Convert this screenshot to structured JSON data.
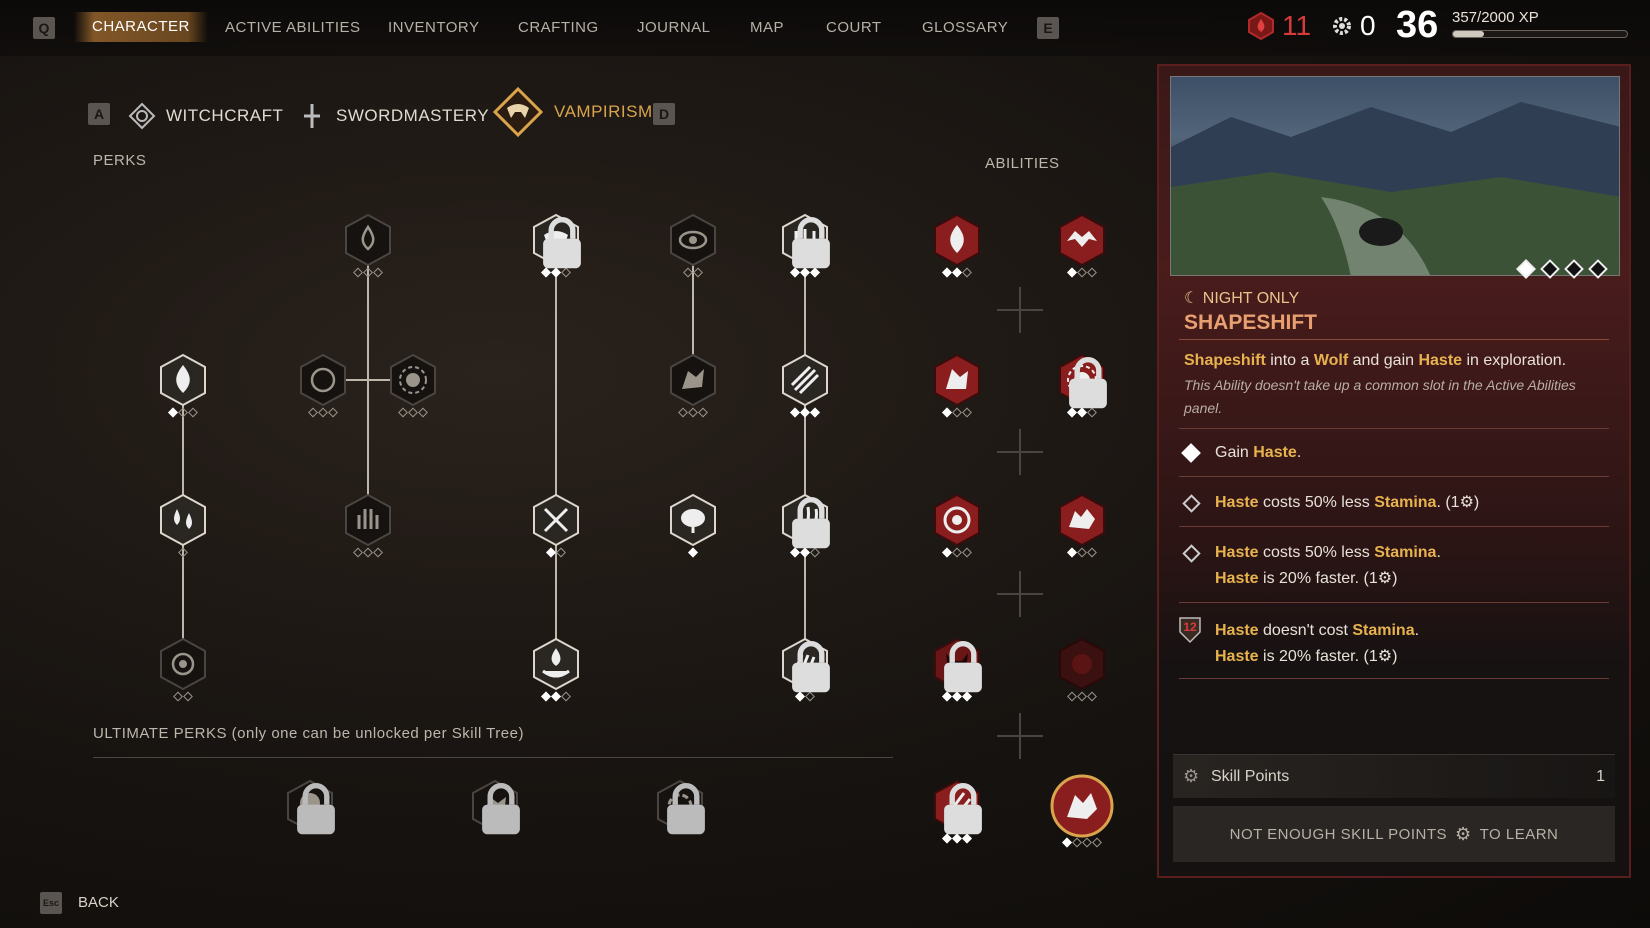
{
  "nav": {
    "left_key": "Q",
    "right_key": "E",
    "tabs": [
      "CHARACTER",
      "ACTIVE ABILITIES",
      "INVENTORY",
      "CRAFTING",
      "JOURNAL",
      "MAP",
      "COURT",
      "GLOSSARY"
    ],
    "active_tab": "CHARACTER"
  },
  "stats": {
    "blood": "11",
    "skill_points": "0",
    "level": "36",
    "xp_text": "357/2000 XP",
    "xp_fraction": 0.18
  },
  "trees": {
    "left_key": "A",
    "right_key": "D",
    "items": [
      "WITCHCRAFT",
      "SWORDMASTERY",
      "VAMPIRISM"
    ],
    "active": "VAMPIRISM"
  },
  "labels": {
    "perks": "PERKS",
    "abilities": "ABILITIES",
    "ultimate": "ULTIMATE PERKS (only one can be unlocked per Skill Tree)",
    "back_key": "Esc",
    "back": "BACK"
  },
  "detail": {
    "tag": "NIGHT ONLY",
    "title": "SHAPESHIFT",
    "desc_parts": [
      "Shapeshift",
      " into a ",
      "Wolf",
      " and gain ",
      "Haste",
      " in exploration."
    ],
    "note": "This Ability doesn't take up a common slot in the Active Abilities panel.",
    "rank1": [
      "Gain ",
      "Haste",
      "."
    ],
    "rank2": [
      "Haste",
      " costs 50% less ",
      "Stamina",
      ".  (1",
      ")"
    ],
    "rank3a": [
      "Haste",
      " costs 50% less ",
      "Stamina",
      "."
    ],
    "rank3b": [
      "Haste",
      " is 20% faster.  (1",
      ")"
    ],
    "rank4_badge": "12",
    "rank4a": [
      "Haste",
      " doesn't cost ",
      "Stamina",
      "."
    ],
    "rank4b": [
      "Haste",
      " is 20% faster.  (1",
      ")"
    ],
    "skill_points_label": "Skill Points",
    "skill_points_value": "1",
    "learn_a": "NOT ENOUGH SKILL POINTS",
    "learn_b": "TO LEARN",
    "gallery_selected": 1,
    "gallery_count": 4
  },
  "colors": {
    "accent_gold": "#d9a44c",
    "blood_red": "#d83a3a",
    "highlight": "#e8b34f",
    "panel_red": "#4a1c1c"
  }
}
